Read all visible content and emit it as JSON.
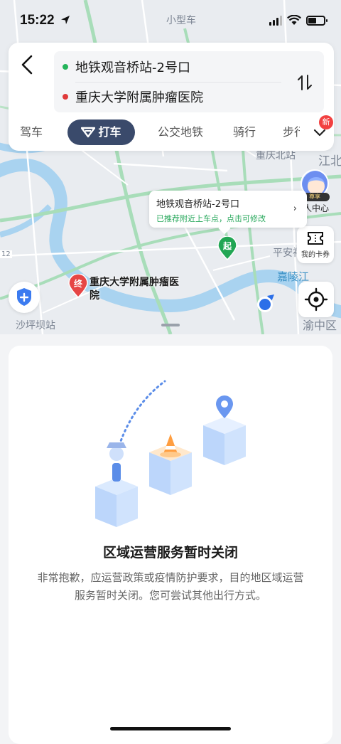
{
  "status": {
    "time": "15:22"
  },
  "route": {
    "origin": "地铁观音桥站-2号口",
    "destination": "重庆大学附属肿瘤医院"
  },
  "modes": {
    "items": [
      "驾车",
      "打车",
      "公交地铁",
      "骑行",
      "步行"
    ],
    "active": "打车",
    "badge": "新"
  },
  "map": {
    "labels": {
      "top": "小型车",
      "north": "重庆北站",
      "edge_right": "江北",
      "pinganli": "平安祠",
      "river": "嘉陵江",
      "yuzhong": "渝中区",
      "station": "沙坪坝站",
      "route_num": "12"
    },
    "pickup": {
      "title": "地铁观音桥站-2号口",
      "hint": "已推荐附近上车点，点击可修改",
      "pin": "起"
    },
    "destination": {
      "pin": "终",
      "label": "重庆大学附属肿瘤医院"
    },
    "side": {
      "avatar_tag": "尊享",
      "personal": "个人中心",
      "coupon": "我的卡券"
    }
  },
  "panel": {
    "title": "区域运营服务暂时关闭",
    "description": "非常抱歉，应运营政策或疫情防护要求，目的地区域运营服务暂时关闭。您可尝试其他出行方式。"
  },
  "colors": {
    "accent_tab": "#3a4a6b",
    "origin_dot": "#23b45a",
    "destination_dot": "#e03a3a",
    "hint_green": "#27a85b",
    "badge_red": "#f24040",
    "river_blue": "#3f93c6"
  }
}
